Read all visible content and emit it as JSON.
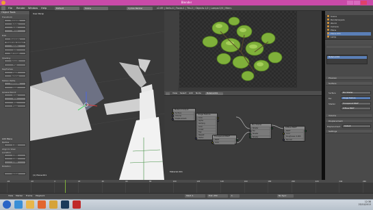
{
  "window": {
    "title": "Blender"
  },
  "menu": [
    "File",
    "Render",
    "Window",
    "Help"
  ],
  "header": {
    "layout": "Default",
    "scene": "Scene",
    "engine": "Cycles Render",
    "stats": "v2.69 | Verts:4 | Faces:1 | Tris:2 | Objects:1/2 | Lamps:0/0 | Mem:"
  },
  "tool_shelf": {
    "header": "Object Tools",
    "sections": [
      {
        "label": "Transform",
        "buttons": [
          "Translate",
          "Rotate",
          "Scale",
          "Mirror"
        ]
      },
      {
        "label": "Edit",
        "buttons": [
          "Duplicate",
          "Duplicate Linked",
          "Delete",
          "Join",
          "Set Origin"
        ]
      },
      {
        "label": "Shading",
        "buttons": [
          "Smooth",
          "Flat"
        ]
      },
      {
        "label": "Keyframes",
        "buttons": [
          "Insert",
          "Remove"
        ]
      },
      {
        "label": "Motion Paths",
        "buttons": [
          "Calculate",
          "Clear"
        ]
      },
      {
        "label": "Grease Pencil",
        "buttons": [
          "Draw",
          "Line",
          "Poly",
          "Erase"
        ]
      }
    ],
    "operator": {
      "title": "Add Plane",
      "radius_label": "Radius",
      "radius": "1.000",
      "align_label": "Align to View",
      "location_label": "Location",
      "loc": [
        "0.000",
        "0.000",
        "0.000"
      ],
      "rotation_label": "Rotation"
    },
    "view_label": "Global"
  },
  "viewport": {
    "label": "User Persp",
    "object_label": "(1) Plane.001"
  },
  "node_editor": {
    "material_label": "Material.001",
    "header_items": [
      "View",
      "Select",
      "Add",
      "Node"
    ],
    "material_field": "Material.001",
    "nodes": [
      {
        "id": "output",
        "title": "Material Output",
        "rows": [
          "Surface",
          "Volume",
          "Displacement"
        ]
      },
      {
        "id": "image",
        "title": "Image Texture",
        "rows": [
          "Color",
          "Alpha",
          "leaf.png",
          "Color",
          "Linear",
          "Flat",
          "Repeat",
          "Vector"
        ]
      },
      {
        "id": "mix",
        "title": "Mix Shader",
        "rows": [
          "Shader",
          "Fac",
          "Shader",
          "Shader"
        ]
      },
      {
        "id": "transp",
        "title": "Transparent BSDF",
        "rows": [
          "BSDF",
          "Color"
        ]
      },
      {
        "id": "diffuse",
        "title": "Diffuse BSDF",
        "rows": [
          "BSDF",
          "Color",
          "Roughness: 0.000",
          "Normal"
        ]
      }
    ]
  },
  "outliner": {
    "items": [
      "Scene",
      "RenderLayers",
      "World",
      "Camera",
      "Plane",
      "Plane.001",
      "Lamp"
    ]
  },
  "properties": {
    "material_slot": "Material.001",
    "sections": [
      "Preview",
      "Surface",
      "Volume",
      "Displacement",
      "Settings"
    ],
    "surface_label": "Surface",
    "surface_value": "Mix Shader",
    "fac_label": "Fac",
    "fac_value": "Image Texture",
    "shader_label": "Shader",
    "shader1": "Transparent BSDF",
    "shader2": "Diffuse BSDF",
    "displacement_label": "Displacement",
    "displacement_value": "Default"
  },
  "timeline": {
    "items": [
      "View",
      "Marker",
      "Frame",
      "Playback"
    ],
    "start_label": "Start: 1",
    "end_label": "End: 250",
    "current": "1",
    "sync": "No Sync",
    "ticks": [
      "-40",
      "-20",
      "0",
      "20",
      "40",
      "60",
      "80",
      "100",
      "120",
      "140",
      "160",
      "180",
      "200",
      "220",
      "240",
      "260"
    ]
  },
  "taskbar": {
    "apps": [
      {
        "name": "start-icon",
        "color": "#2a64c6"
      },
      {
        "name": "ie-icon",
        "color": "#3a8fd6"
      },
      {
        "name": "explorer-icon",
        "color": "#e8b64a"
      },
      {
        "name": "media-icon",
        "color": "#e2662f"
      },
      {
        "name": "chrome-icon",
        "color": "#d6a338"
      },
      {
        "name": "photoshop-icon",
        "color": "#1b3a5a"
      },
      {
        "name": "recorder-icon",
        "color": "#c02a2a"
      }
    ],
    "time": "12:38",
    "date": "25/10/2013"
  },
  "colors": {
    "title_bar": "#c94aa8",
    "selected_blue": "#5a7fb7",
    "leaf_green": "#7fb03a"
  }
}
